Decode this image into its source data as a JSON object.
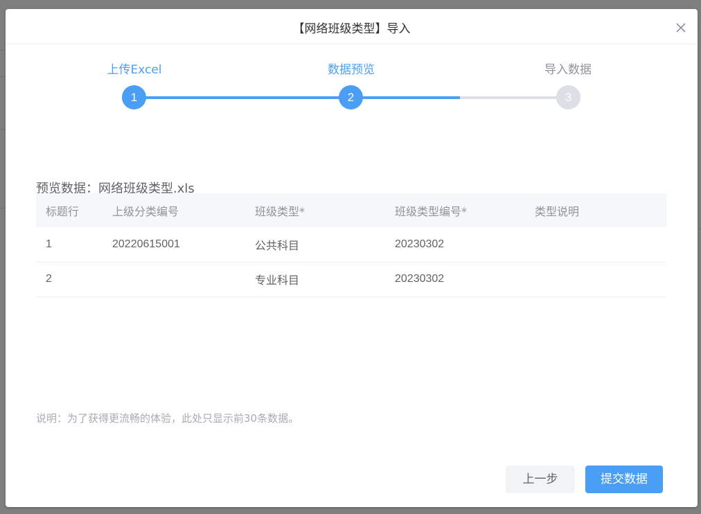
{
  "dialog": {
    "title": "【网络班级类型】导入",
    "close_icon": "close-icon"
  },
  "steps": [
    {
      "title": "上传Excel",
      "number": "1",
      "status": "active"
    },
    {
      "title": "数据预览",
      "number": "2",
      "status": "active"
    },
    {
      "title": "导入数据",
      "number": "3",
      "status": "wait"
    }
  ],
  "preview": {
    "label": "预览数据：网络班级类型.xls",
    "columns": [
      "标题行",
      "上级分类编号",
      "班级类型*",
      "班级类型编号*",
      "类型说明"
    ],
    "rows": [
      [
        "1",
        "20220615001",
        "公共科目",
        "20230302",
        ""
      ],
      [
        "2",
        "",
        "专业科目",
        "20230302",
        ""
      ]
    ]
  },
  "note": "说明：为了获得更流畅的体验，此处只显示前30条数据。",
  "buttons": {
    "prev": "上一步",
    "submit": "提交数据"
  },
  "colors": {
    "primary": "#4a9ff5",
    "wait": "#dcdfe6"
  }
}
